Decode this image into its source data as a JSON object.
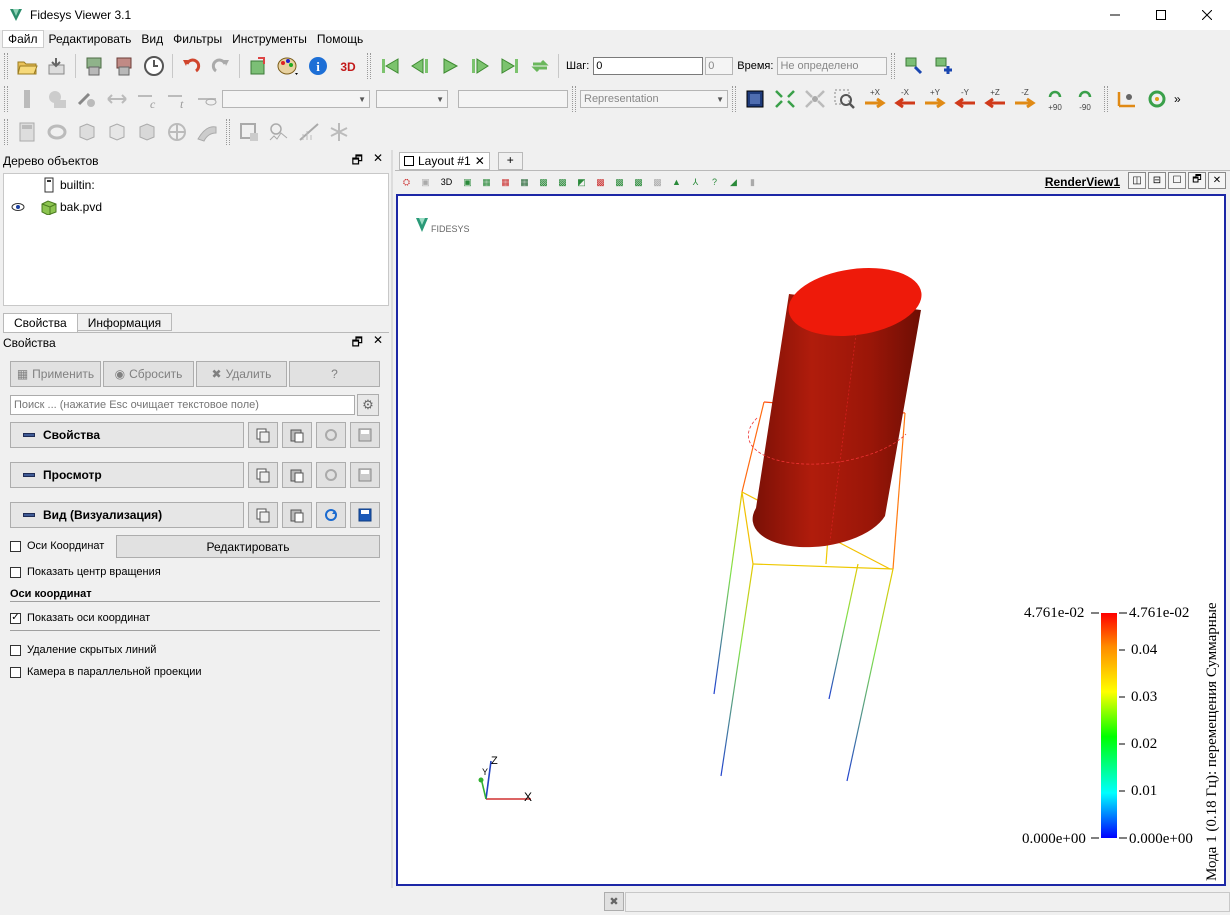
{
  "window": {
    "title": "Fidesys Viewer 3.1"
  },
  "menu": [
    "Файл",
    "Редактировать",
    "Вид",
    "Фильтры",
    "Инструменты",
    "Помощь"
  ],
  "toolbar": {
    "step_label": "Шаг:",
    "step_value": "0",
    "step_max": "0",
    "time_label": "Время:",
    "time_value": "Не определено",
    "representation_placeholder": "Representation",
    "axis_buttons": [
      "+X",
      "-X",
      "+Y",
      "-Y",
      "+Z",
      "-Z",
      "+90",
      "-90"
    ]
  },
  "pipeline": {
    "title": "Дерево объектов",
    "items": [
      {
        "label": "builtin:"
      },
      {
        "label": "bak.pvd"
      }
    ]
  },
  "tabs": [
    "Свойства",
    "Информация"
  ],
  "properties": {
    "title": "Свойства",
    "apply": "Применить",
    "reset": "Сбросить",
    "delete": "Удалить",
    "help": "?",
    "search_placeholder": "Поиск ... (нажатие Esc очищает текстовое поле)",
    "sections": [
      "Свойства",
      "Просмотр",
      "Вид (Визуализация)"
    ],
    "axes_grid_label": "Оси Координат",
    "edit_button": "Редактировать",
    "show_center_label": "Показать центр вращения",
    "axes_group_title": "Оси координат",
    "show_axes_label": "Показать оси координат",
    "hidden_lines_label": "Удаление скрытых линий",
    "parallel_projection_label": "Камера в параллельной проекции"
  },
  "view": {
    "layout_tab": "Layout #1",
    "add_tab": "+",
    "render_view_title": "RenderView1",
    "logo_text": "FIDESYS",
    "axes": {
      "x": "X",
      "y": "Y",
      "z": "Z"
    },
    "colorbar": {
      "title": "Мода 1 (0.18 Гц): перемещения Суммарные",
      "max_label": "4.761e-02",
      "min_label": "0.000e+00",
      "ticks": [
        "0.04",
        "0.03",
        "0.02",
        "0.01"
      ],
      "colors": [
        "#ff0000",
        "#ff8c00",
        "#ffff00",
        "#00ff00",
        "#00ffff",
        "#0000ff"
      ]
    }
  }
}
